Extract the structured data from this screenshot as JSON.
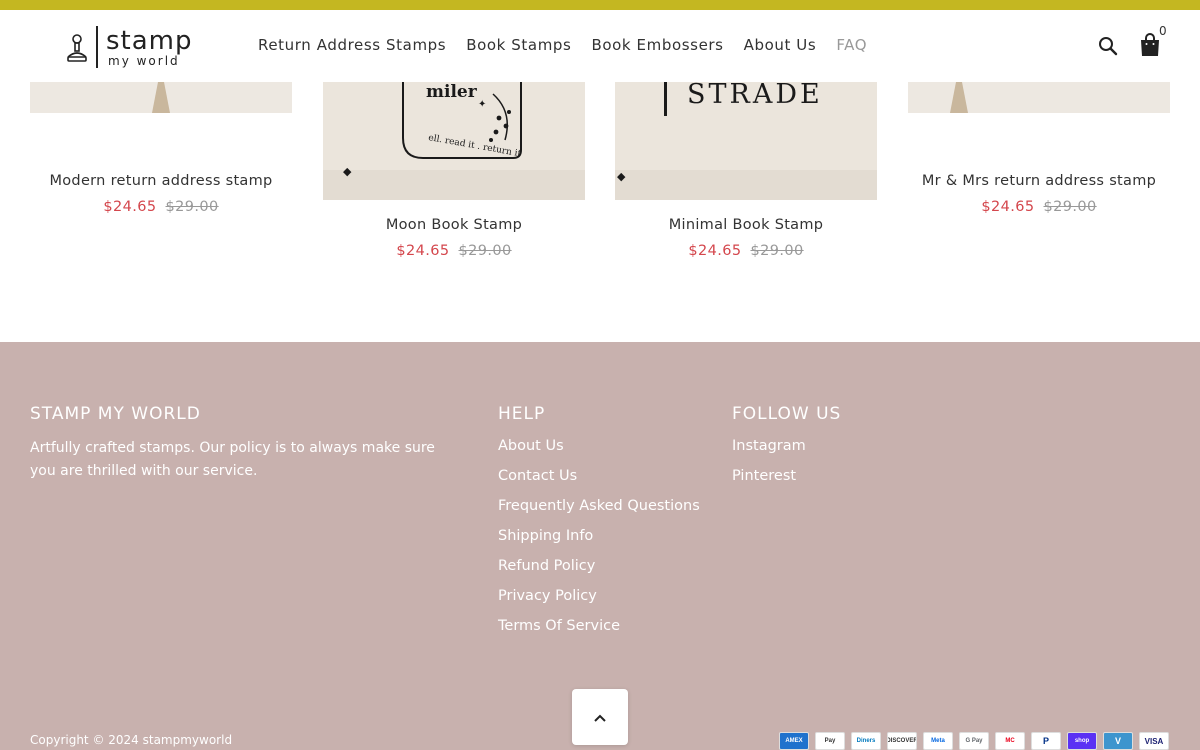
{
  "header": {
    "logo_main": "stamp",
    "logo_sub": "my world",
    "nav": [
      "Return Address Stamps",
      "Book Stamps",
      "Book Embossers",
      "About Us",
      "FAQ"
    ],
    "cart_count": "0"
  },
  "products": [
    {
      "name": "Modern return address stamp",
      "sale_price": "$24.65",
      "original_price": "$29.00"
    },
    {
      "name": "Moon Book Stamp",
      "sale_price": "$24.65",
      "original_price": "$29.00",
      "image_text": "miler",
      "image_arc_text": "ell. read it . return it"
    },
    {
      "name": "Minimal Book Stamp",
      "sale_price": "$24.65",
      "original_price": "$29.00",
      "image_text": "STRADE"
    },
    {
      "name": "Mr & Mrs return address stamp",
      "sale_price": "$24.65",
      "original_price": "$29.00"
    }
  ],
  "footer": {
    "about_heading": "STAMP MY WORLD",
    "about_text": "Artfully crafted stamps. Our policy is to always make sure you are thrilled with our service.",
    "help_heading": "HELP",
    "help_links": [
      "About Us",
      "Contact Us",
      "Frequently Asked Questions",
      "Shipping Info",
      "Refund Policy",
      "Privacy Policy",
      "Terms Of Service"
    ],
    "follow_heading": "FOLLOW US",
    "follow_links": [
      "Instagram",
      "Pinterest"
    ],
    "copyright": "Copyright © 2024 stampmyworld",
    "payment_methods": [
      "AMEX",
      "Pay",
      "Diners",
      "DISCOVER",
      "Meta",
      "G Pay",
      "MC",
      "P",
      "shop",
      "V",
      "VISA"
    ]
  },
  "colors": {
    "topbar": "#c4b721",
    "footer_bg": "#c8b1ae",
    "sale_price": "#d4474d"
  }
}
